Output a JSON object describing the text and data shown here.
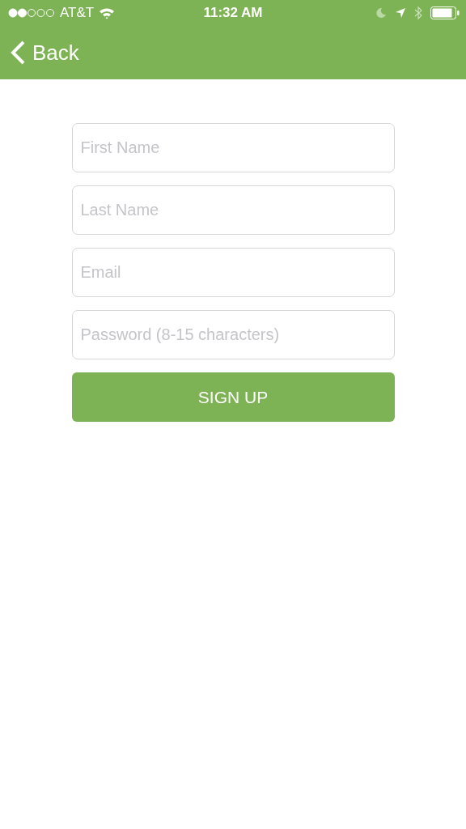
{
  "status_bar": {
    "carrier": "AT&T",
    "time": "11:32 AM"
  },
  "nav_bar": {
    "back_label": "Back"
  },
  "form": {
    "fields": [
      {
        "placeholder": "First Name"
      },
      {
        "placeholder": "Last Name"
      },
      {
        "placeholder": "Email"
      },
      {
        "placeholder": "Password (8-15 characters)"
      }
    ],
    "submit_label": "SIGN UP"
  }
}
